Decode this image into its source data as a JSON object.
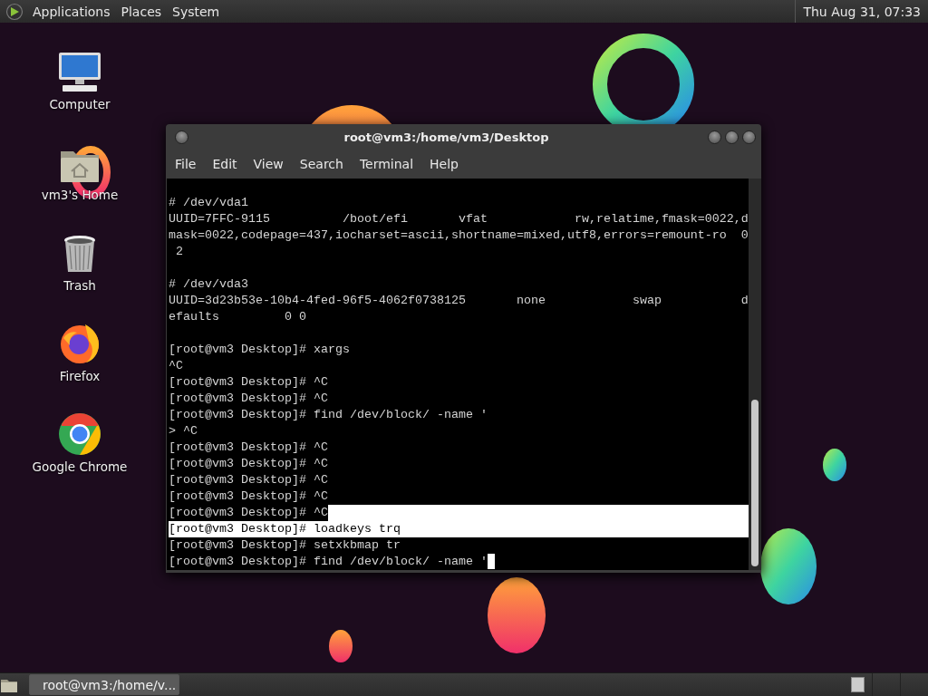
{
  "top_panel": {
    "menus": [
      "Applications",
      "Places",
      "System"
    ],
    "clock": "Thu Aug 31, 07:33"
  },
  "desktop_icons": [
    {
      "label": "Computer",
      "kind": "computer"
    },
    {
      "label": "vm3's Home",
      "kind": "home"
    },
    {
      "label": "Trash",
      "kind": "trash"
    },
    {
      "label": "Firefox",
      "kind": "firefox"
    },
    {
      "label": "Google Chrome",
      "kind": "chrome"
    }
  ],
  "terminal": {
    "title": "root@vm3:/home/vm3/Desktop",
    "menu": [
      "File",
      "Edit",
      "View",
      "Search",
      "Terminal",
      "Help"
    ],
    "lines": [
      {
        "kind": "blank"
      },
      {
        "kind": "plain",
        "text": "# /dev/vda1"
      },
      {
        "kind": "plain",
        "text": "UUID=7FFC-9115          /boot/efi       vfat            rw,relatime,fmask=0022,d"
      },
      {
        "kind": "plain",
        "text": "mask=0022,codepage=437,iocharset=ascii,shortname=mixed,utf8,errors=remount-ro  0"
      },
      {
        "kind": "plain",
        "text": " 2"
      },
      {
        "kind": "blank"
      },
      {
        "kind": "plain",
        "text": "# /dev/vda3"
      },
      {
        "kind": "plain",
        "text": "UUID=3d23b53e-10b4-4fed-96f5-4062f0738125       none            swap           d"
      },
      {
        "kind": "plain",
        "text": "efaults         0 0"
      },
      {
        "kind": "blank"
      },
      {
        "kind": "plain",
        "text": "[root@vm3 Desktop]# xargs"
      },
      {
        "kind": "plain",
        "text": "^C"
      },
      {
        "kind": "plain",
        "text": "[root@vm3 Desktop]# ^C"
      },
      {
        "kind": "plain",
        "text": "[root@vm3 Desktop]# ^C"
      },
      {
        "kind": "plain",
        "text": "[root@vm3 Desktop]# find /dev/block/ -name '"
      },
      {
        "kind": "plain",
        "text": "> ^C"
      },
      {
        "kind": "plain",
        "text": "[root@vm3 Desktop]# ^C"
      },
      {
        "kind": "plain",
        "text": "[root@vm3 Desktop]# ^C"
      },
      {
        "kind": "plain",
        "text": "[root@vm3 Desktop]# ^C"
      },
      {
        "kind": "plain",
        "text": "[root@vm3 Desktop]# ^C"
      },
      {
        "kind": "selection-start",
        "text": "[root@vm3 Desktop]# ^C"
      },
      {
        "kind": "selected",
        "text": "[root@vm3 Desktop]# loadkeys trq"
      },
      {
        "kind": "plain",
        "text": "[root@vm3 Desktop]# setxkbmap tr"
      },
      {
        "kind": "plain",
        "text": "[root@vm3 Desktop]# find /dev/block/ -name '",
        "cursor": true
      }
    ]
  },
  "taskbar": {
    "tasks": [
      {
        "label": "root@vm3:/home/v...",
        "selected": true
      }
    ]
  }
}
